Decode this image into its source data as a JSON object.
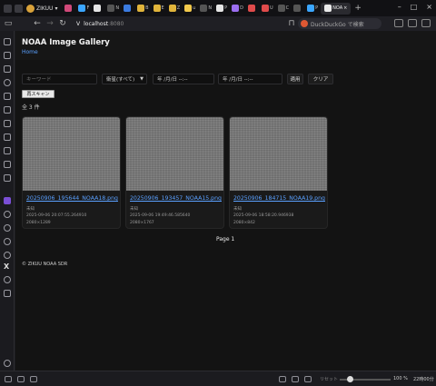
{
  "browser": {
    "profile_name": "ZIKUU",
    "tabs": [
      "",
      "F",
      "",
      "N",
      "",
      "B",
      "E",
      "Z",
      "u",
      "N",
      "P",
      "D",
      "",
      "U",
      "C",
      "",
      "P",
      "NOA"
    ],
    "search_placeholder": "DuckDuckGo で検索",
    "url_host": "localhost",
    "url_port": ":8080",
    "status_reset": "リセット",
    "zoom": "100 %",
    "time": "22時00分"
  },
  "header": {
    "title": "NOAA Image Gallery",
    "home_link": "Home"
  },
  "filters": {
    "keyword_placeholder": "キーワード",
    "satellite_select": "衛星(すべて)",
    "date_from": "年 /月/日 --:--",
    "date_to": "年 /月/日 --:--",
    "apply_label": "適用",
    "clear_label": "クリア",
    "rescan_label": "再スキャン"
  },
  "count_text": "全 3 件",
  "images": [
    {
      "filename": "20250906_195644_NOAA18.png",
      "status": "未知",
      "timestamp": "2025-09-06 20:07:55.264910",
      "size": "2080×1289"
    },
    {
      "filename": "20250906_193457_NOAA15.png",
      "status": "未知",
      "timestamp": "2025-09-06 19:49:46.585640",
      "size": "2080×1767"
    },
    {
      "filename": "20250906_184715_NOAA19.png",
      "status": "未知",
      "timestamp": "2025-09-06 18:58:20.946938",
      "size": "2080×842"
    }
  ],
  "pagination": {
    "label": "Page 1"
  },
  "footer": {
    "text": "© ZIKUU NOAA SDR"
  },
  "colors": {
    "link": "#5aa0ff",
    "background": "#131313",
    "card": "#1a1a1a"
  }
}
